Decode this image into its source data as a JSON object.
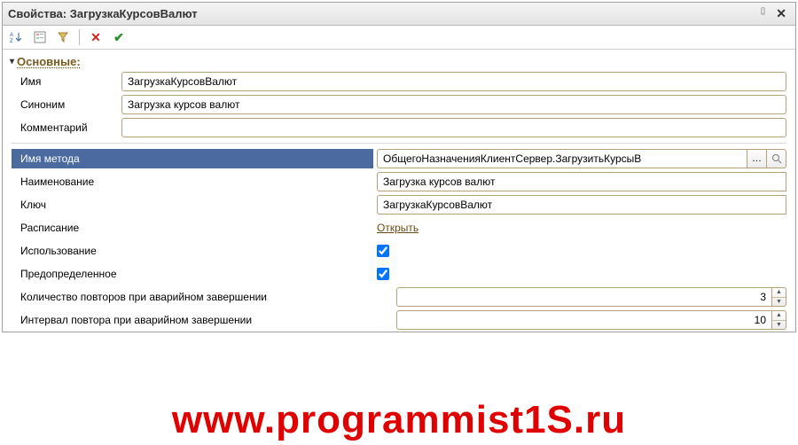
{
  "window": {
    "title": "Свойства: ЗагрузкаКурсовВалют"
  },
  "section": {
    "main": "Основные:"
  },
  "labels": {
    "name": "Имя",
    "synonym": "Синоним",
    "comment": "Комментарий",
    "method": "Имя метода",
    "display": "Наименование",
    "key": "Ключ",
    "schedule": "Расписание",
    "usage": "Использование",
    "predefined": "Предопределенное",
    "retries": "Количество повторов при аварийном завершении",
    "interval": "Интервал повтора при аварийном завершении"
  },
  "values": {
    "name": "ЗагрузкаКурсовВалют",
    "synonym": "Загрузка курсов валют",
    "comment": "",
    "method": "ОбщегоНазначенияКлиентСервер.ЗагрузитьКурсыВ",
    "display": "Загрузка курсов валют",
    "key": "ЗагрузкаКурсовВалют",
    "schedule_link": "Открыть",
    "usage": true,
    "predefined": true,
    "retries": "3",
    "interval": "10"
  },
  "watermark": "www.programmist1S.ru"
}
